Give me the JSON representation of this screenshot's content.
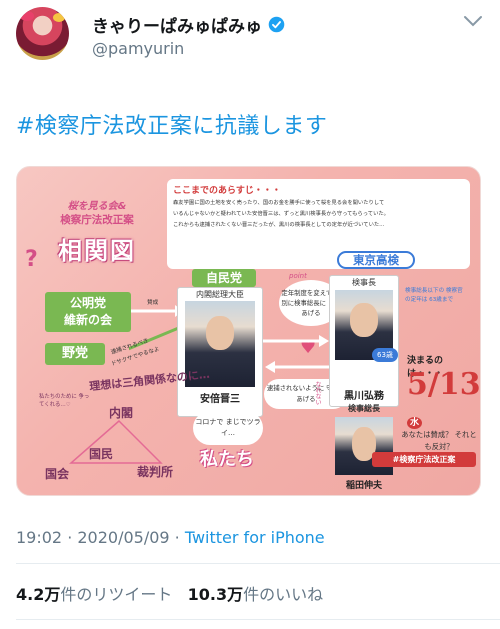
{
  "user": {
    "display_name": "きゃりーぱみゅぱみゅ",
    "handle": "@pamyurin"
  },
  "tweet": {
    "text": "#検察庁法改正案に抗議します"
  },
  "image": {
    "title_top": "桜を見る会&",
    "title_main": "検察庁法改正案",
    "title_big": "相関図",
    "story_head": "ここまでのあらすじ・・・",
    "story_lines": [
      "森友学園に国の土地を安く売ったり、国のお金を勝手に使って桜を見る会を開いたりして",
      "いるんじゃないかと疑われていた安倍晋三は、ずっと黒川検事長から守ってもらっていた。",
      "これからも逮捕されたくない晋三だったが、黒川の検事長としての定年が近づいていた…"
    ],
    "koumei_line1": "公明党",
    "koumei_line2": "維新の会",
    "yatou": "野党",
    "ldp": "自民党",
    "pm_title": "内閣総理大臣",
    "pm_name": "安倍晋三",
    "point": "point",
    "bubble_text": "定年制度を変えて 特別に検事総長に してあげる",
    "bubble2_text": "逮捕されないように 守ってあげる",
    "tokyo": "東京高検",
    "kenji_title": "検事長",
    "kenji_age": "63歳",
    "kenji_name": "黒川弘務",
    "side_note": "検事総長以下の 検察官の定年は 63歳まで",
    "nareta": "なれない",
    "soucho_title": "検事総長",
    "soucho_name": "稲田伸夫",
    "kimaru": "決まるのは・・・",
    "date": "5/13",
    "date_day": "水",
    "question": "あなたは賛成？ それとも反対？",
    "hashtag": "#検察庁法改正案",
    "ideal": "理想は三角関係なのに…",
    "cabinet": "内閣",
    "citizen": "国民",
    "diet": "国会",
    "court": "裁判所",
    "left_note": "私たちのために 争ってくれる…♡",
    "corona": "コロナで まじでツライ…",
    "watashi": "私たち",
    "arrow_sansei": "賛成",
    "arrow_tadashii": "ヤダヤダ",
    "arrow_left1": "逮捕されるべき",
    "arrow_left2": "ドサクサでやるなよ"
  },
  "meta": {
    "time_date": "19:02 · 2020/05/09 · ",
    "source": "Twitter for iPhone"
  },
  "stats": {
    "retweets_count": "4.2万",
    "retweets_label": "件のリツイート",
    "likes_count": "10.3万",
    "likes_label": "件のいいね"
  }
}
